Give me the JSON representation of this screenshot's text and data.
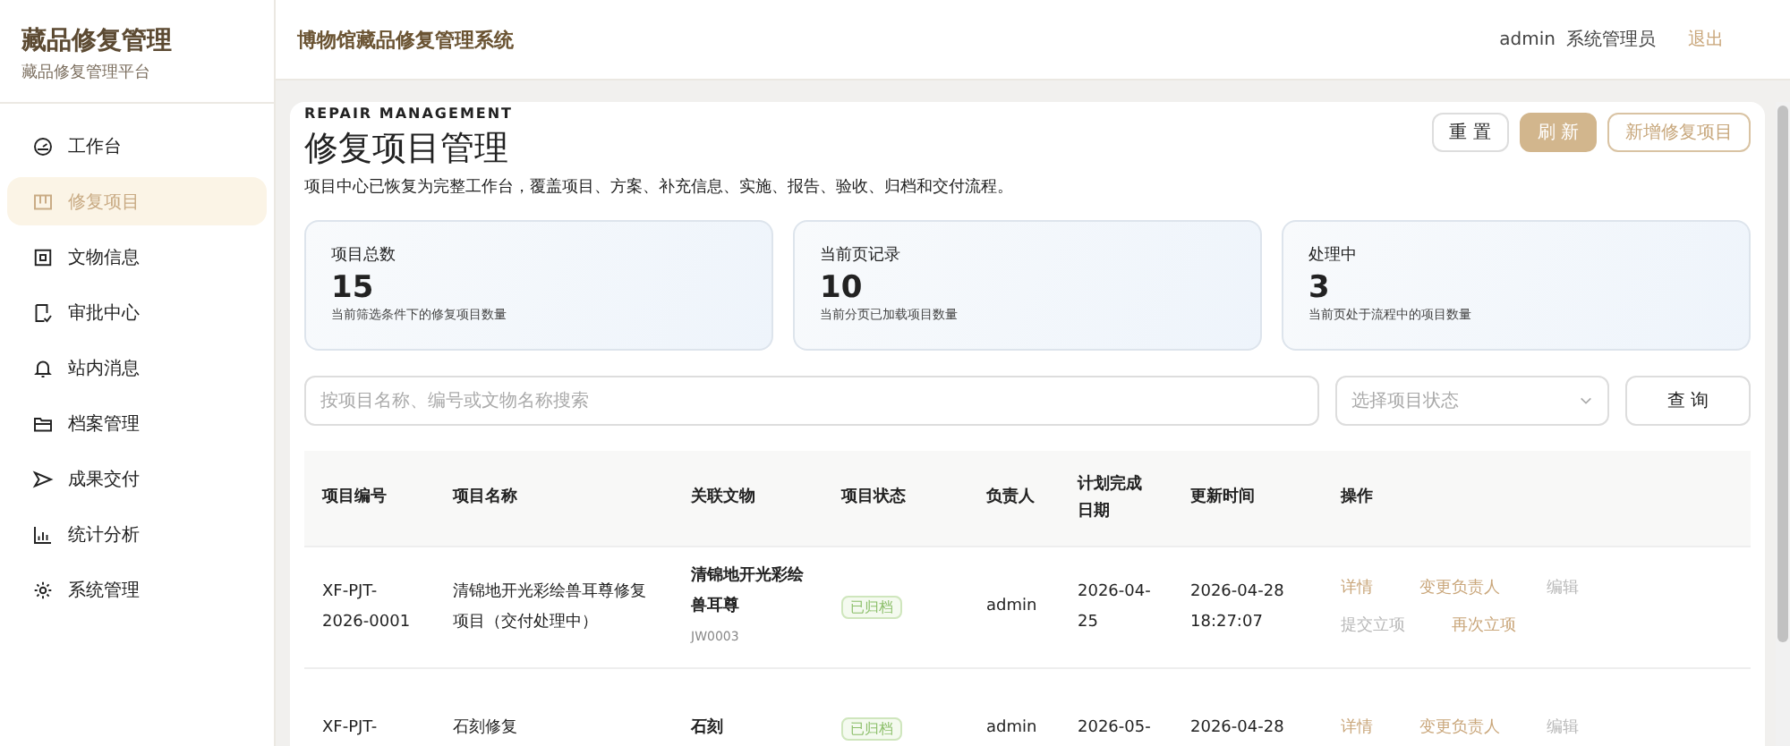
{
  "sidebar": {
    "title": "藏品修复管理",
    "subtitle": "藏品修复管理平台",
    "items": [
      {
        "label": "工作台",
        "kind": "dashboard",
        "selected": false
      },
      {
        "label": "修复项目",
        "kind": "project",
        "selected": true
      },
      {
        "label": "文物信息",
        "kind": "relic",
        "selected": false
      },
      {
        "label": "审批中心",
        "kind": "approval",
        "selected": false
      },
      {
        "label": "站内消息",
        "kind": "bell",
        "selected": false
      },
      {
        "label": "档案管理",
        "kind": "folder",
        "selected": false
      },
      {
        "label": "成果交付",
        "kind": "send",
        "selected": false
      },
      {
        "label": "统计分析",
        "kind": "chart",
        "selected": false
      },
      {
        "label": "系统管理",
        "kind": "gear",
        "selected": false
      }
    ]
  },
  "header": {
    "title": "博物馆藏品修复管理系统",
    "user": "admin",
    "role": "系统管理员",
    "logout": "退出"
  },
  "page": {
    "eyebrow": "REPAIR MANAGEMENT",
    "title": "修复项目管理",
    "description": "项目中心已恢复为完整工作台，覆盖项目、方案、补充信息、实施、报告、验收、归档和交付流程。",
    "buttons": [
      {
        "label": "重 置",
        "kind": "plain"
      },
      {
        "label": "刷 新",
        "kind": "primary"
      },
      {
        "label": "新增修复项目",
        "kind": "outline"
      }
    ]
  },
  "stats": [
    {
      "label": "项目总数",
      "value": "15",
      "note": "当前筛选条件下的修复项目数量"
    },
    {
      "label": "当前页记录",
      "value": "10",
      "note": "当前分页已加载项目数量"
    },
    {
      "label": "处理中",
      "value": "3",
      "note": "当前页处于流程中的项目数量"
    }
  ],
  "filters": {
    "search_placeholder": "按项目名称、编号或文物名称搜索",
    "status_placeholder": "选择项目状态",
    "query_button": "查 询"
  },
  "table": {
    "columns": [
      "项目编号",
      "项目名称",
      "关联文物",
      "项目状态",
      "负责人",
      "计划完成日期",
      "更新时间",
      "操作"
    ],
    "rows": [
      {
        "id": "XF-PJT-2026-0001",
        "name": "清锦地开光彩绘兽耳尊修复项目（交付处理中）",
        "relic": "清锦地开光彩绘兽耳尊",
        "relic_code": "JW0003",
        "status": "已归档",
        "owner": "admin",
        "planned": "2026-04-25",
        "updated": "2026-04-28 18:27:07",
        "actions": [
          {
            "label": "详情",
            "disabled": false
          },
          {
            "label": "变更负责人",
            "disabled": false
          },
          {
            "label": "编辑",
            "disabled": true
          },
          {
            "label": "提交立项",
            "disabled": true
          },
          {
            "label": "再次立项",
            "disabled": false
          }
        ]
      },
      {
        "id": "XF-PJT-",
        "name": "石刻修复",
        "relic": "石刻",
        "status": "已归档",
        "owner": "admin",
        "planned": "2026-05-",
        "updated": "2026-04-28",
        "actions": [
          {
            "label": "详情",
            "disabled": false
          },
          {
            "label": "变更负责人",
            "disabled": false
          },
          {
            "label": "编辑",
            "disabled": true
          }
        ]
      }
    ]
  }
}
